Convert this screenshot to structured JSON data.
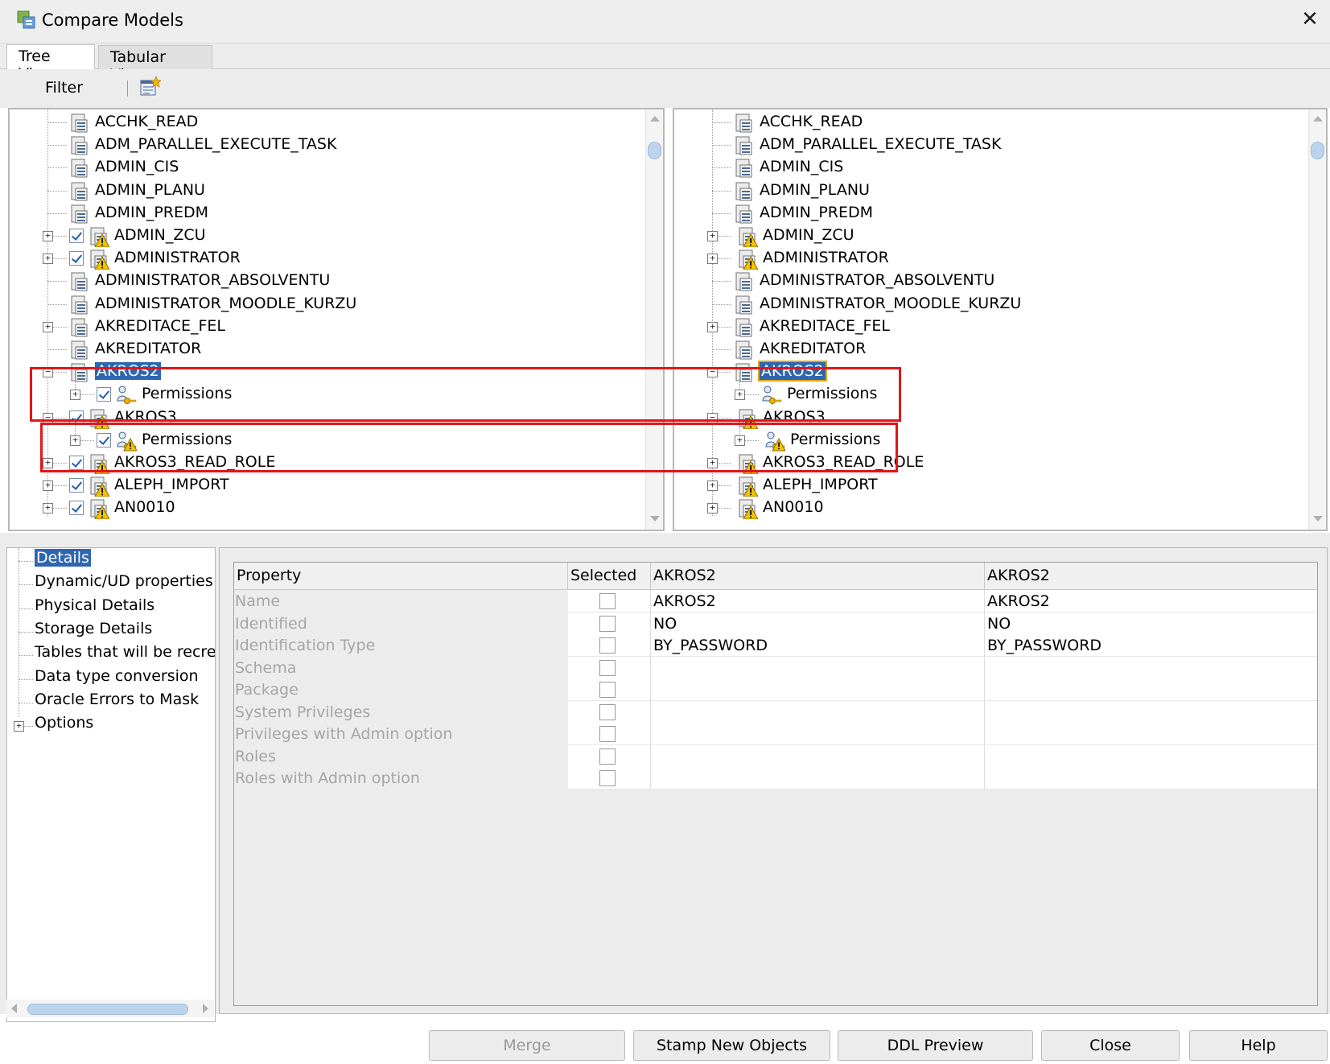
{
  "window": {
    "title": "Compare Models",
    "close_glyph": "✕"
  },
  "tabs": [
    {
      "label": "Tree View",
      "active": true
    },
    {
      "label": "Tabular View",
      "active": false
    }
  ],
  "toolbar": {
    "filter_label": "Filter",
    "filter_icon": "filter-settings-icon"
  },
  "left_tree": {
    "rows": [
      {
        "label": "ACCHK_READ",
        "type": "user",
        "expander": false,
        "checked": false,
        "warning": false
      },
      {
        "label": "ADM_PARALLEL_EXECUTE_TASK",
        "type": "user",
        "expander": false,
        "checked": false,
        "warning": false
      },
      {
        "label": "ADMIN_CIS",
        "type": "user",
        "expander": false,
        "checked": false,
        "warning": false
      },
      {
        "label": "ADMIN_PLANU",
        "type": "user",
        "expander": false,
        "checked": false,
        "warning": false
      },
      {
        "label": "ADMIN_PREDM",
        "type": "user",
        "expander": false,
        "checked": false,
        "warning": false
      },
      {
        "label": "ADMIN_ZCU",
        "type": "user",
        "expander": true,
        "checked": true,
        "warning": true
      },
      {
        "label": "ADMINISTRATOR",
        "type": "user",
        "expander": true,
        "checked": true,
        "warning": true
      },
      {
        "label": "ADMINISTRATOR_ABSOLVENTU",
        "type": "user",
        "expander": false,
        "checked": false,
        "warning": false
      },
      {
        "label": "ADMINISTRATOR_MOODLE_KURZU",
        "type": "user",
        "expander": false,
        "checked": false,
        "warning": false
      },
      {
        "label": "AKREDITACE_FEL",
        "type": "user",
        "expander": true,
        "checked": false,
        "warning": false
      },
      {
        "label": "AKREDITATOR",
        "type": "user",
        "expander": false,
        "checked": false,
        "warning": false
      },
      {
        "label": "AKROS2",
        "type": "user",
        "expander": true,
        "checked": false,
        "warning": false,
        "selected": true
      },
      {
        "label": "Permissions",
        "type": "permission",
        "expander": true,
        "checked": true,
        "warning": false,
        "child": true
      },
      {
        "label": "AKROS3",
        "type": "user",
        "expander": true,
        "checked": true,
        "warning": true
      },
      {
        "label": "Permissions",
        "type": "permission",
        "expander": true,
        "checked": true,
        "warning": true,
        "child": true
      },
      {
        "label": "AKROS3_READ_ROLE",
        "type": "user",
        "expander": true,
        "checked": true,
        "warning": true
      },
      {
        "label": "ALEPH_IMPORT",
        "type": "user",
        "expander": true,
        "checked": true,
        "warning": true
      },
      {
        "label": "AN0010",
        "type": "user",
        "expander": true,
        "checked": true,
        "warning": true
      }
    ]
  },
  "right_tree": {
    "rows": [
      {
        "label": "ACCHK_READ",
        "type": "user",
        "expander": false,
        "warning": false
      },
      {
        "label": "ADM_PARALLEL_EXECUTE_TASK",
        "type": "user",
        "expander": false,
        "warning": false
      },
      {
        "label": "ADMIN_CIS",
        "type": "user",
        "expander": false,
        "warning": false
      },
      {
        "label": "ADMIN_PLANU",
        "type": "user",
        "expander": false,
        "warning": false
      },
      {
        "label": "ADMIN_PREDM",
        "type": "user",
        "expander": false,
        "warning": false
      },
      {
        "label": "ADMIN_ZCU",
        "type": "user",
        "expander": true,
        "warning": true
      },
      {
        "label": "ADMINISTRATOR",
        "type": "user",
        "expander": true,
        "warning": true
      },
      {
        "label": "ADMINISTRATOR_ABSOLVENTU",
        "type": "user",
        "expander": false,
        "warning": false
      },
      {
        "label": "ADMINISTRATOR_MOODLE_KURZU",
        "type": "user",
        "expander": false,
        "warning": false
      },
      {
        "label": "AKREDITACE_FEL",
        "type": "user",
        "expander": true,
        "warning": false
      },
      {
        "label": "AKREDITATOR",
        "type": "user",
        "expander": false,
        "warning": false
      },
      {
        "label": "AKROS2",
        "type": "user",
        "expander": true,
        "warning": false,
        "selected": true
      },
      {
        "label": "Permissions",
        "type": "permission",
        "expander": true,
        "warning": false,
        "child": true
      },
      {
        "label": "AKROS3",
        "type": "user",
        "expander": true,
        "warning": true
      },
      {
        "label": "Permissions",
        "type": "permission",
        "expander": true,
        "warning": true,
        "child": true
      },
      {
        "label": "AKROS3_READ_ROLE",
        "type": "user",
        "expander": true,
        "warning": true
      },
      {
        "label": "ALEPH_IMPORT",
        "type": "user",
        "expander": true,
        "warning": true
      },
      {
        "label": "AN0010",
        "type": "user",
        "expander": true,
        "warning": true
      }
    ]
  },
  "nav": {
    "items": [
      {
        "label": "Details",
        "selected": true
      },
      {
        "label": "Dynamic/UD properties"
      },
      {
        "label": "Physical Details"
      },
      {
        "label": "Storage Details"
      },
      {
        "label": "Tables that will be recreated"
      },
      {
        "label": "Data type conversion"
      },
      {
        "label": "Oracle Errors to Mask"
      },
      {
        "label": "Options",
        "expander": true
      }
    ]
  },
  "grid": {
    "headers": [
      "Property",
      "Selected",
      "AKROS2",
      "AKROS2"
    ],
    "rows": [
      {
        "property": "Name",
        "left": "AKROS2",
        "right": "AKROS2"
      },
      {
        "property": "Identified",
        "left": "NO",
        "right": "NO"
      },
      {
        "property": "Identification Type",
        "left": "BY_PASSWORD",
        "right": "BY_PASSWORD"
      },
      {
        "property": "Schema",
        "left": "",
        "right": ""
      },
      {
        "property": "Package",
        "left": "",
        "right": ""
      },
      {
        "property": "System Privileges",
        "left": "",
        "right": ""
      },
      {
        "property": "Privileges with Admin option",
        "left": "",
        "right": ""
      },
      {
        "property": "Roles",
        "left": "",
        "right": ""
      },
      {
        "property": "Roles with Admin option",
        "left": "",
        "right": ""
      }
    ]
  },
  "buttons": {
    "merge": "Merge",
    "stamp": "Stamp New Objects",
    "ddl": "DDL Preview",
    "close": "Close",
    "help": "Help"
  },
  "colors": {
    "selection": "#2f66b1",
    "highlight_box": "#e0151b",
    "warning": "#f2c200"
  }
}
